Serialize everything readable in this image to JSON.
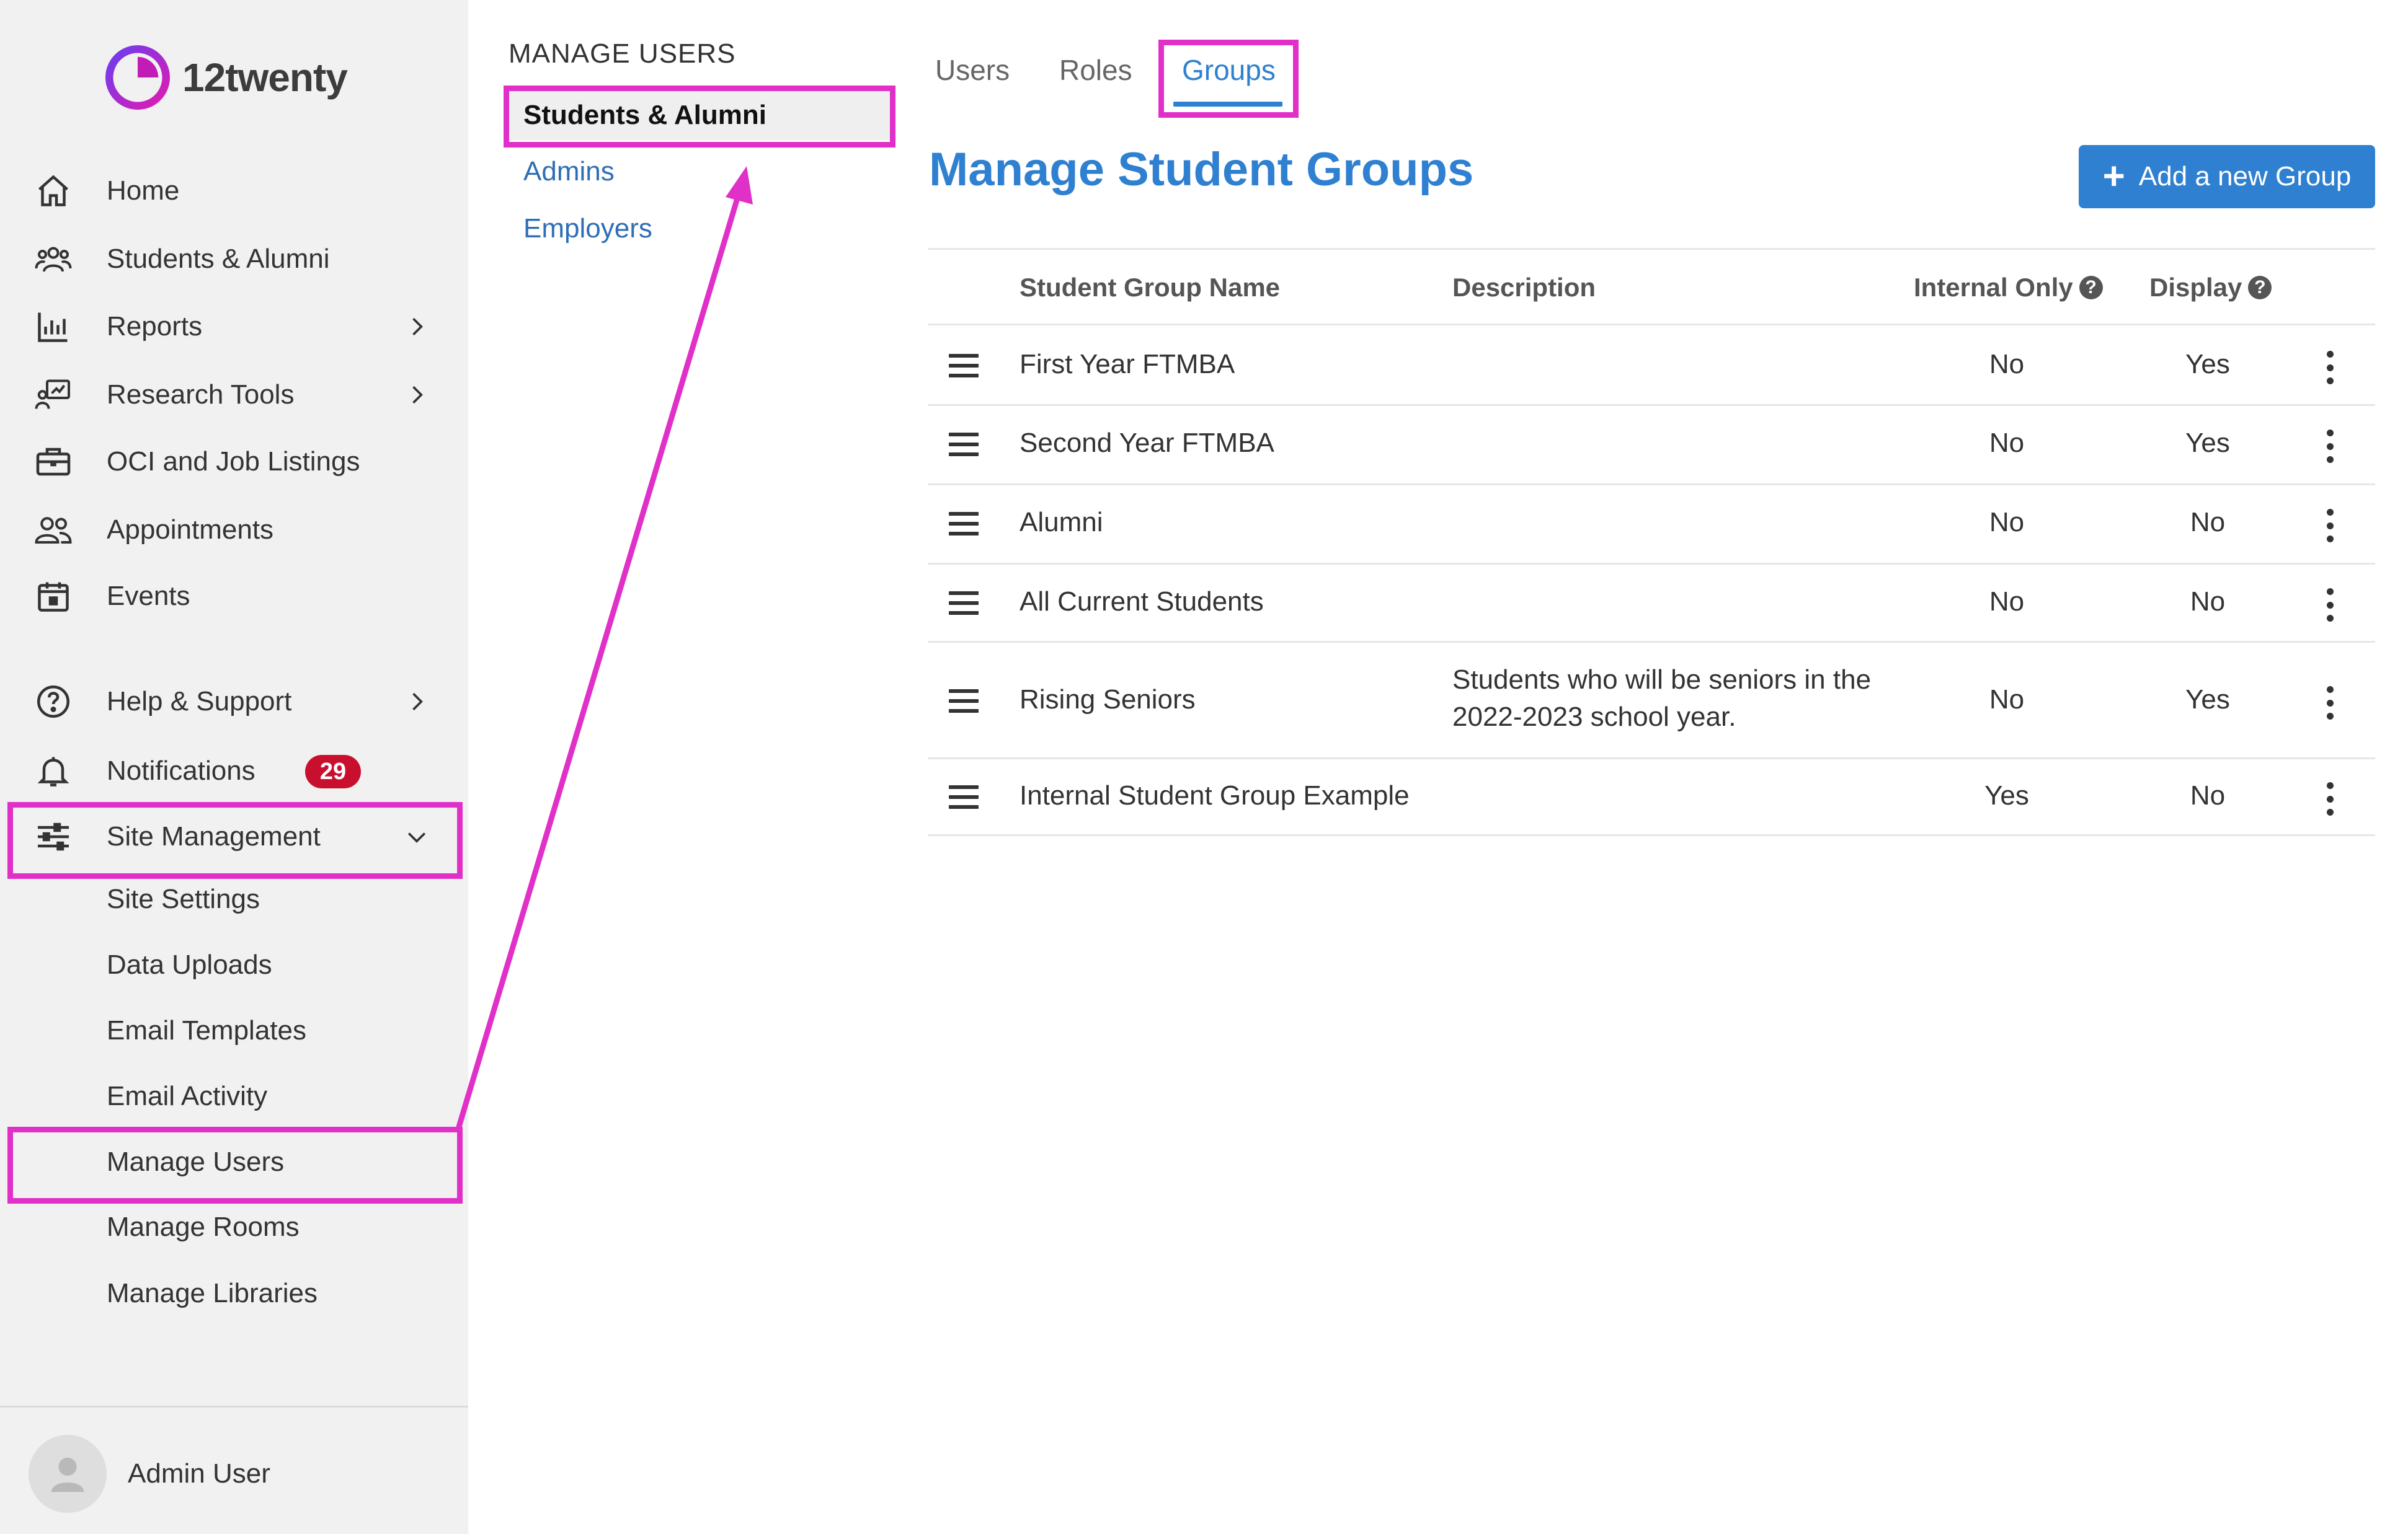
{
  "app": {
    "brand": "12twenty",
    "brand_color": "#c21cb7"
  },
  "sidebar": {
    "items": [
      {
        "id": "home",
        "label": "Home",
        "icon": "home-icon"
      },
      {
        "id": "students",
        "label": "Students & Alumni",
        "icon": "users-icon"
      },
      {
        "id": "reports",
        "label": "Reports",
        "icon": "bar-chart-icon",
        "has_children": true
      },
      {
        "id": "research",
        "label": "Research Tools",
        "icon": "research-icon",
        "has_children": true
      },
      {
        "id": "oci",
        "label": "OCI and Job Listings",
        "icon": "briefcase-icon"
      },
      {
        "id": "appointments",
        "label": "Appointments",
        "icon": "people-icon"
      },
      {
        "id": "events",
        "label": "Events",
        "icon": "calendar-icon"
      },
      {
        "id": "help",
        "label": "Help & Support",
        "icon": "help-icon",
        "has_children": true
      },
      {
        "id": "notifications",
        "label": "Notifications",
        "icon": "bell-icon",
        "badge": "29"
      },
      {
        "id": "site-management",
        "label": "Site Management",
        "icon": "sliders-icon",
        "expanded": true
      }
    ],
    "sub_items": [
      "Site Settings",
      "Data Uploads",
      "Email Templates",
      "Email Activity",
      "Manage Users",
      "Manage Rooms",
      "Manage Libraries"
    ],
    "user": {
      "name": "Admin User"
    }
  },
  "submenu": {
    "heading": "MANAGE USERS",
    "active": "Students & Alumni",
    "links": [
      "Admins",
      "Employers"
    ]
  },
  "tabs": [
    {
      "label": "Users",
      "active": false
    },
    {
      "label": "Roles",
      "active": false
    },
    {
      "label": "Groups",
      "active": true
    }
  ],
  "main": {
    "title": "Manage Student Groups",
    "add_button": "Add a new Group",
    "columns": {
      "name": "Student Group Name",
      "description": "Description",
      "internal": "Internal Only",
      "display": "Display"
    },
    "rows": [
      {
        "name": "First Year FTMBA",
        "description": "",
        "internal": "No",
        "display": "Yes"
      },
      {
        "name": "Second Year FTMBA",
        "description": "",
        "internal": "No",
        "display": "Yes"
      },
      {
        "name": "Alumni",
        "description": "",
        "internal": "No",
        "display": "No"
      },
      {
        "name": "All Current Students",
        "description": "",
        "internal": "No",
        "display": "No"
      },
      {
        "name": "Rising Seniors",
        "description_line1": "Students who will be seniors in the",
        "description_line2": "2022-2023 school year.",
        "internal": "No",
        "display": "Yes"
      },
      {
        "name": "Internal Student Group Example",
        "description": "",
        "internal": "Yes",
        "display": "No"
      }
    ]
  },
  "colors": {
    "accent": "#2f80d1",
    "highlight": "#e030c8",
    "badge": "#c8102e",
    "sidebar_bg": "#f1f1f1"
  }
}
